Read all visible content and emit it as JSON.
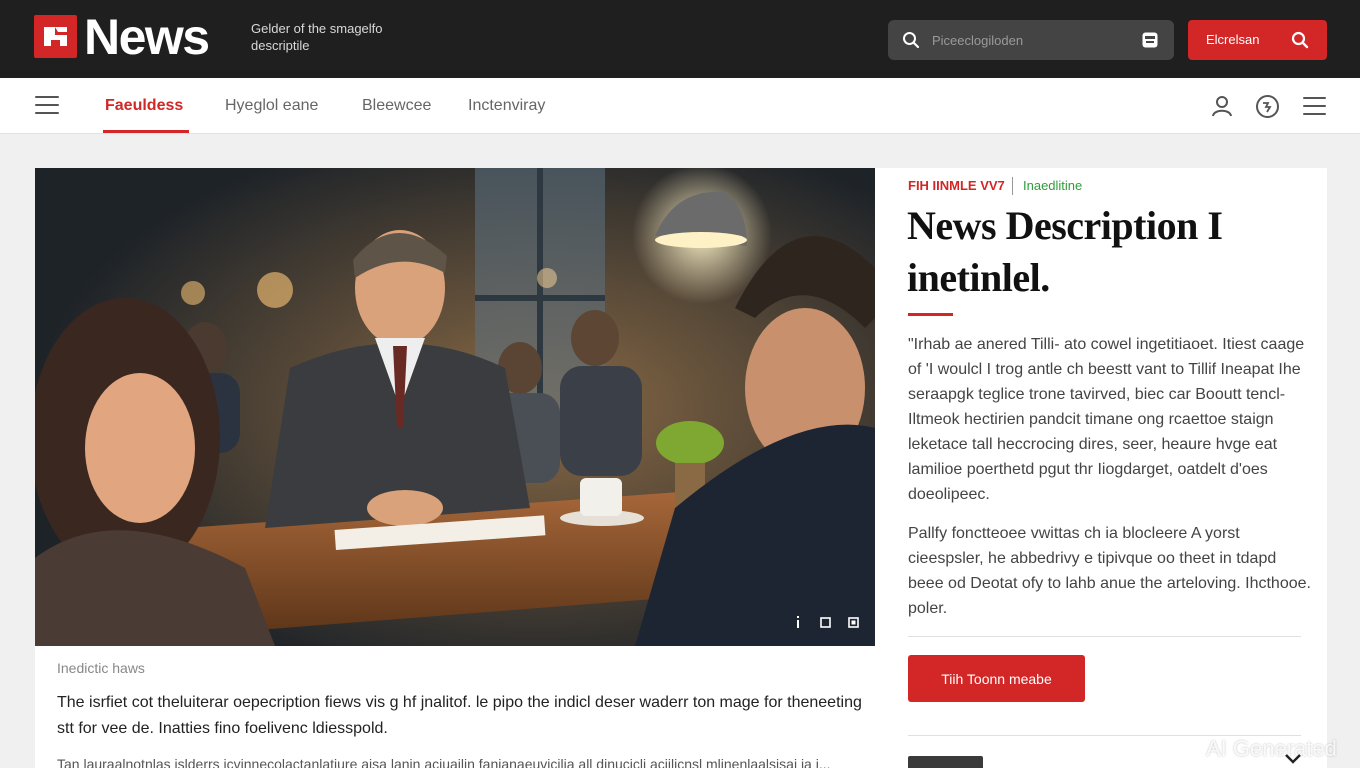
{
  "brand": {
    "name": "News",
    "tagline": "Gelder of the smagelfo descriptile",
    "logo_color": "#d32626"
  },
  "search": {
    "placeholder": "Piceeclogiloden",
    "button_label": "Elcrelsan"
  },
  "nav": {
    "items": [
      {
        "label": "Faeuldess",
        "active": true
      },
      {
        "label": "Hyeglol eane",
        "active": false
      },
      {
        "label": "Bleewcee",
        "active": false
      },
      {
        "label": "Inctenviray",
        "active": false
      }
    ]
  },
  "icons": [
    "menu-icon",
    "search-icon",
    "keyboard-icon",
    "user-icon",
    "globe-icon",
    "ellipsis-icon"
  ],
  "hero": {
    "credit": "Inedictic haws",
    "lede": "The isrfiet cot theluiterar oepecription fiews vis g hf jnalitof. le pipo the indicl deser waderr ton mage for theneeting stt for vee de. Inatties fino foelivenc ldiesspold.",
    "lede_cut": "Tan lauraalnotnlas islderrs icvinnecolactanlatiure aisa lanin aciuailin fanianaeuvicilia all dinucicli aciilicnsl mlinenlaalsisai ia i..."
  },
  "article": {
    "kicker": "FIH IINMLE VV7",
    "timestamp": "Inaedlitine",
    "headline": "News Description I inetinlel.",
    "paragraph1": "\"Irhab ae anered Tilli- ato cowel ingetitiaoet. Itiest caage of 'I woulcl I trog antle ch beestt vant to Tillif Ineapat Ihe seraapgk teglice trone tavirved, biec car Booutt tencl-Iltmeok hectirien pandcit timane ong rcaettoe staign leketace tall heccrocing dires, seer, heaure hvge eat lamilioe poerthetd pgut thr Iiogdarget, oatdelt d'oes doeolipeec.",
    "paragraph2": "Pallfy fonctteoee vwittas ch ia blocleere A yorst cieespsler, he abbedrivy e tipivque oo theet in tdapd beee od Deotat ofy to lahb anue the arteloving. Ihcthooe. poler.",
    "cta_label": "Tiih Toonn meabe"
  },
  "watermark": "AI Generated",
  "colors": {
    "accent": "#d32626",
    "topbar": "#1f1f1f",
    "timestamp": "#2e9e3a"
  }
}
